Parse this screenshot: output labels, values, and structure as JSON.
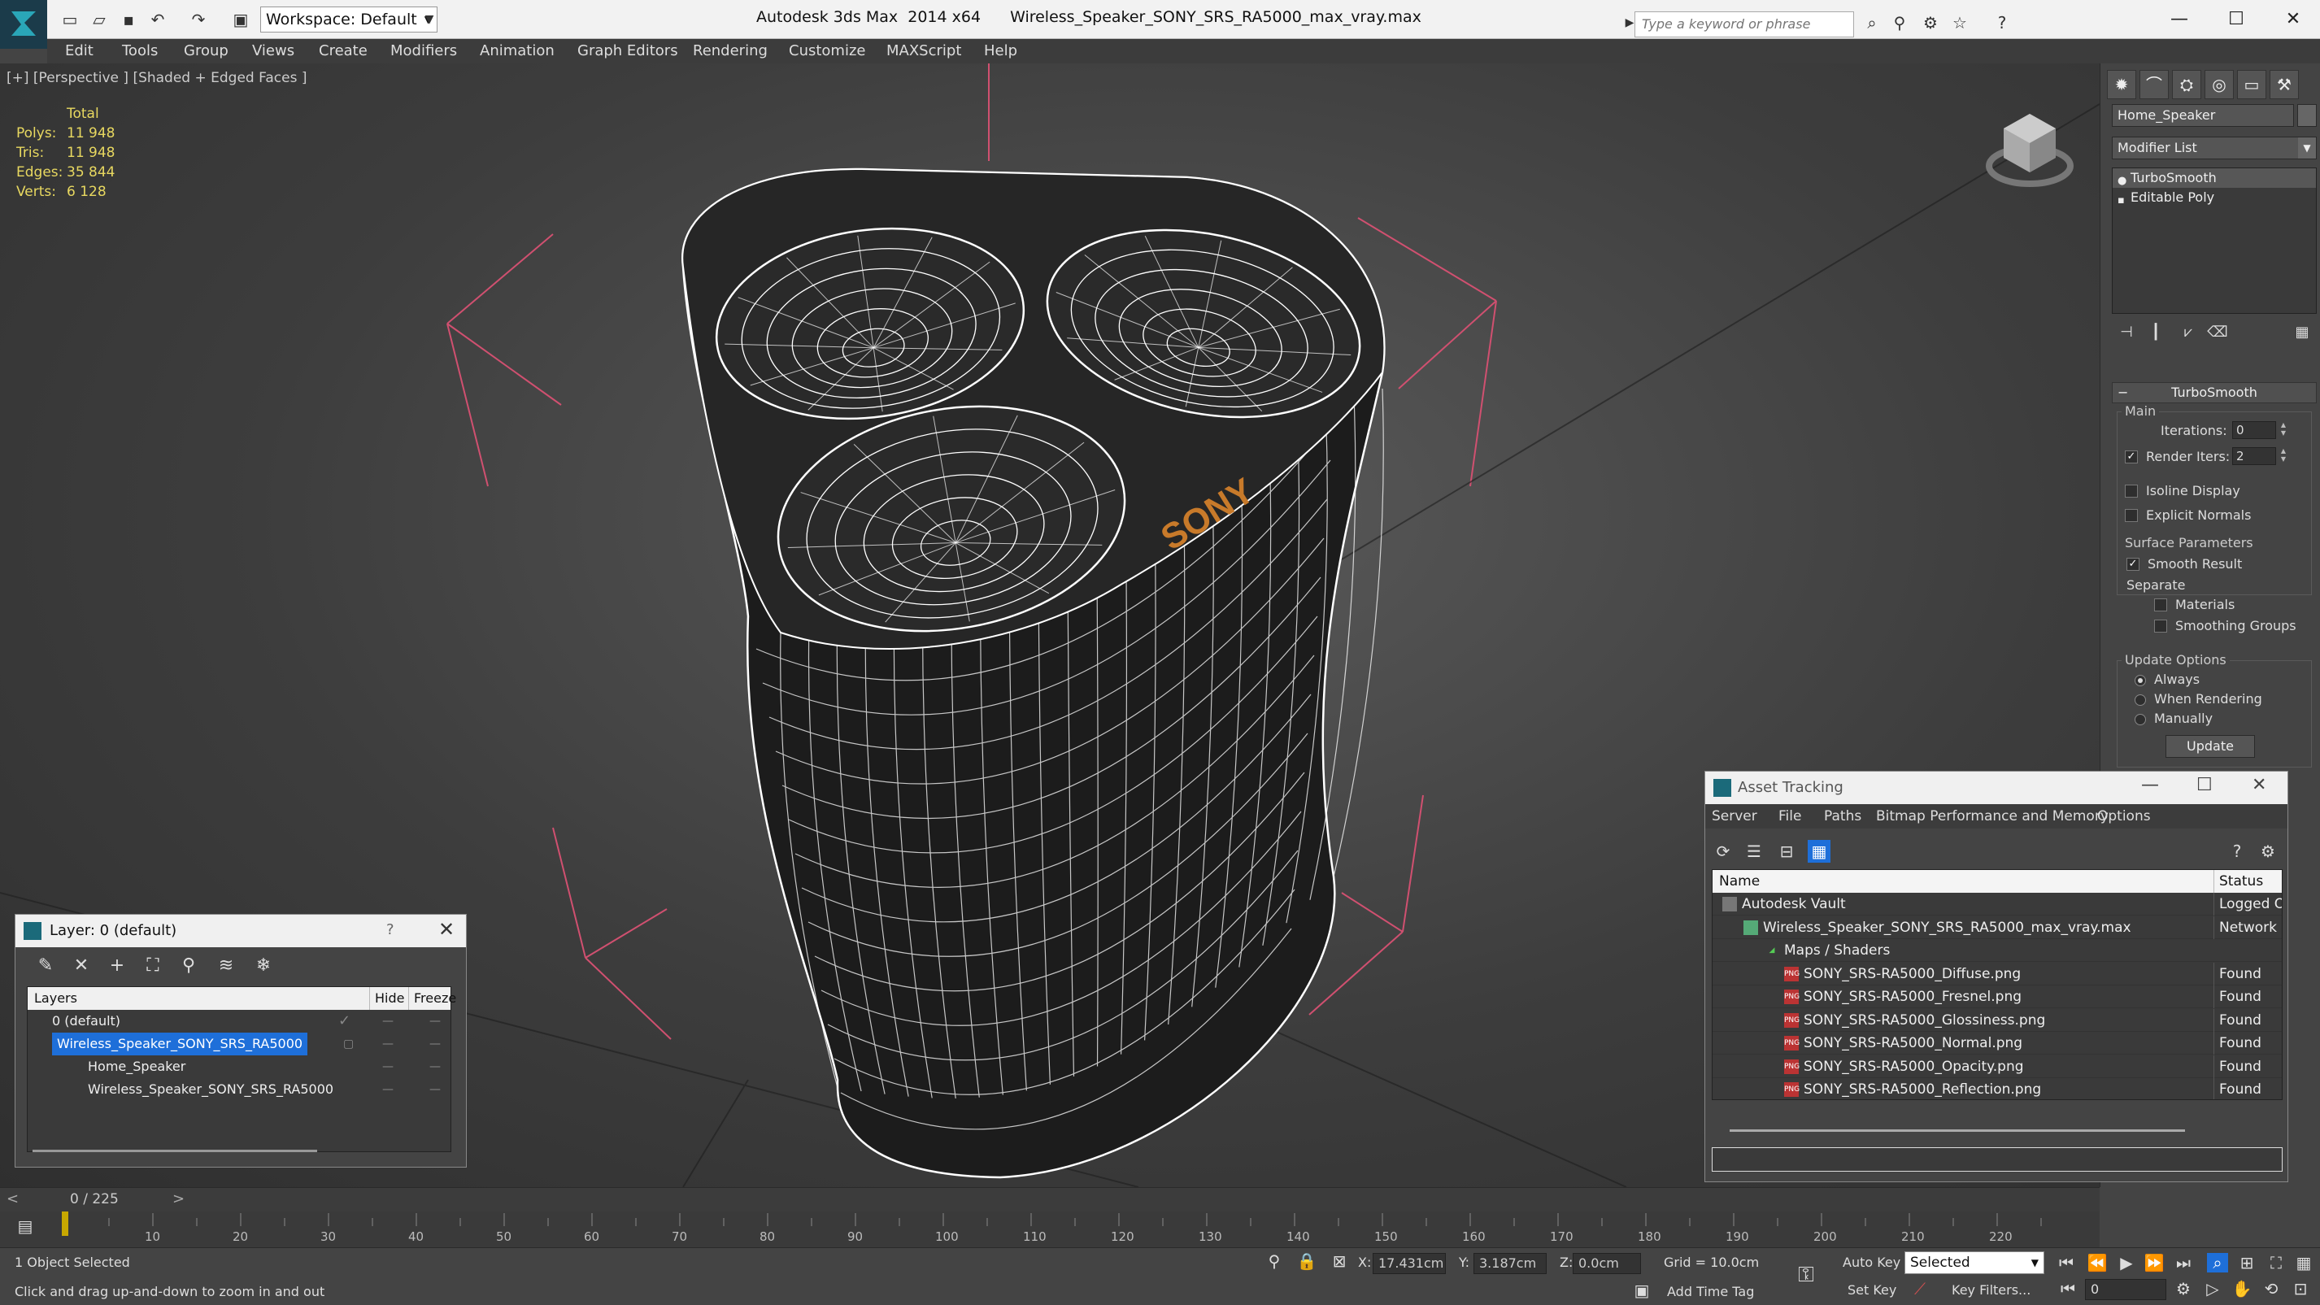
{
  "app": {
    "title": "Autodesk 3ds Max  2014 x64",
    "file": "Wireless_Speaker_SONY_SRS_RA5000_max_vray.max",
    "workspace": "Workspace: Default",
    "search_placeholder": "Type a keyword or phrase"
  },
  "menu": [
    "Edit",
    "Tools",
    "Group",
    "Views",
    "Create",
    "Modifiers",
    "Animation",
    "Graph Editors",
    "Rendering",
    "Customize",
    "MAXScript",
    "Help"
  ],
  "viewport": {
    "label": "[+] [Perspective ] [Shaded + Edged Faces ]",
    "stats": {
      "header": "Total",
      "rows": [
        {
          "k": "Polys:",
          "v": "11 948"
        },
        {
          "k": "Tris:",
          "v": "11 948"
        },
        {
          "k": "Edges:",
          "v": "35 844"
        },
        {
          "k": "Verts:",
          "v": "6 128"
        }
      ]
    },
    "model_logo": "SONY"
  },
  "command_panel": {
    "object_name": "Home_Speaker",
    "modifier_list": "Modifier List",
    "stack": [
      "TurboSmooth",
      "Editable Poly"
    ],
    "rollout_title": "TurboSmooth",
    "main_group": "Main",
    "iterations_label": "Iterations:",
    "iterations_value": "0",
    "render_iters_label": "Render Iters:",
    "render_iters_value": "2",
    "isoline_display": "Isoline Display",
    "explicit_normals": "Explicit Normals",
    "surface_group": "Surface Parameters",
    "smooth_result": "Smooth Result",
    "separate": "Separate",
    "materials": "Materials",
    "smoothing_groups": "Smoothing Groups",
    "update_group": "Update Options",
    "always": "Always",
    "when_rendering": "When Rendering",
    "manually": "Manually",
    "update_button": "Update"
  },
  "layer_dialog": {
    "title": "Layer: 0 (default)",
    "help": "?",
    "col_layers": "Layers",
    "col_hide": "Hide",
    "col_freeze": "Freeze",
    "rows": [
      "0 (default)",
      "Wireless_Speaker_SONY_SRS_RA5000",
      "Home_Speaker",
      "Wireless_Speaker_SONY_SRS_RA5000"
    ]
  },
  "asset_tracking": {
    "title": "Asset Tracking",
    "menu": [
      "Server",
      "File",
      "Paths",
      "Bitmap Performance and Memory",
      "Options"
    ],
    "col_name": "Name",
    "col_status": "Status",
    "rows": [
      {
        "name": "Autodesk Vault",
        "status": "Logged Ou"
      },
      {
        "name": "Wireless_Speaker_SONY_SRS_RA5000_max_vray.max",
        "status": "Network P"
      },
      {
        "name": "Maps / Shaders",
        "status": ""
      },
      {
        "name": "SONY_SRS-RA5000_Diffuse.png",
        "status": "Found"
      },
      {
        "name": "SONY_SRS-RA5000_Fresnel.png",
        "status": "Found"
      },
      {
        "name": "SONY_SRS-RA5000_Glossiness.png",
        "status": "Found"
      },
      {
        "name": "SONY_SRS-RA5000_Normal.png",
        "status": "Found"
      },
      {
        "name": "SONY_SRS-RA5000_Opacity.png",
        "status": "Found"
      },
      {
        "name": "SONY_SRS-RA5000_Reflection.png",
        "status": "Found"
      }
    ],
    "file_icon_text": "PNG"
  },
  "timeline": {
    "frame": "0 / 225",
    "ticks": [
      "10",
      "20",
      "30",
      "40",
      "50",
      "60",
      "70",
      "80",
      "90",
      "100",
      "110",
      "120",
      "130",
      "140",
      "150",
      "160",
      "170",
      "180",
      "190",
      "200",
      "210",
      "220"
    ]
  },
  "status": {
    "selection": "1 Object Selected",
    "prompt": "Click and drag up-and-down to zoom in and out",
    "x_label": "X:",
    "x_value": "17.431cm",
    "y_label": "Y:",
    "y_value": "3.187cm",
    "z_label": "Z:",
    "z_value": "0.0cm",
    "grid": "Grid = 10.0cm",
    "auto_key": "Auto Key",
    "selected": "Selected",
    "set_key": "Set Key",
    "key_filters": "Key Filters...",
    "add_time_tag": "Add Time Tag",
    "frame_value": "0"
  },
  "colors": {
    "viewport_bg": "#3d3d3d",
    "stats_text": "#e8d860",
    "wire": "#ffffff",
    "gizmo": "#d05070",
    "selection": "#1e6fd9",
    "logo": "#c87a2a"
  }
}
